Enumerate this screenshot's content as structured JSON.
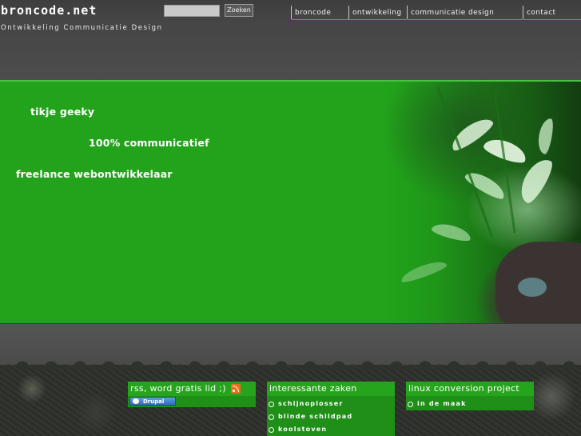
{
  "header": {
    "site_title": "broncode.net",
    "tagline": "Ontwikkeling Communicatie Design",
    "search": {
      "placeholder": "",
      "button_label": "Zoeken"
    },
    "nav": [
      "broncode",
      "ontwikkeling",
      "communicatie",
      "design",
      "contact"
    ]
  },
  "hero": {
    "lines": [
      "tikje geeky",
      "100% communicatief",
      "freelance webontwikkelaar"
    ]
  },
  "footer": {
    "rss_box": {
      "label": "rss, word gratis lid ;)",
      "badge_label": "Drupal"
    },
    "interesting": {
      "title": "interessante zaken",
      "items": [
        "schijnoplosser",
        "blinde schildpad",
        "koolstoven"
      ]
    },
    "linux": {
      "title": "linux conversion project",
      "items": [
        "in de maak"
      ]
    }
  },
  "colors": {
    "hero_green": "#22a31b",
    "box_green": "#1f8f17",
    "box_head_green": "#27a41e",
    "background_gray": "#4a4a4a",
    "rss_orange": "#e8701a"
  },
  "icons": [
    "rss-icon",
    "drupal-icon",
    "bullet-circle-icon"
  ]
}
